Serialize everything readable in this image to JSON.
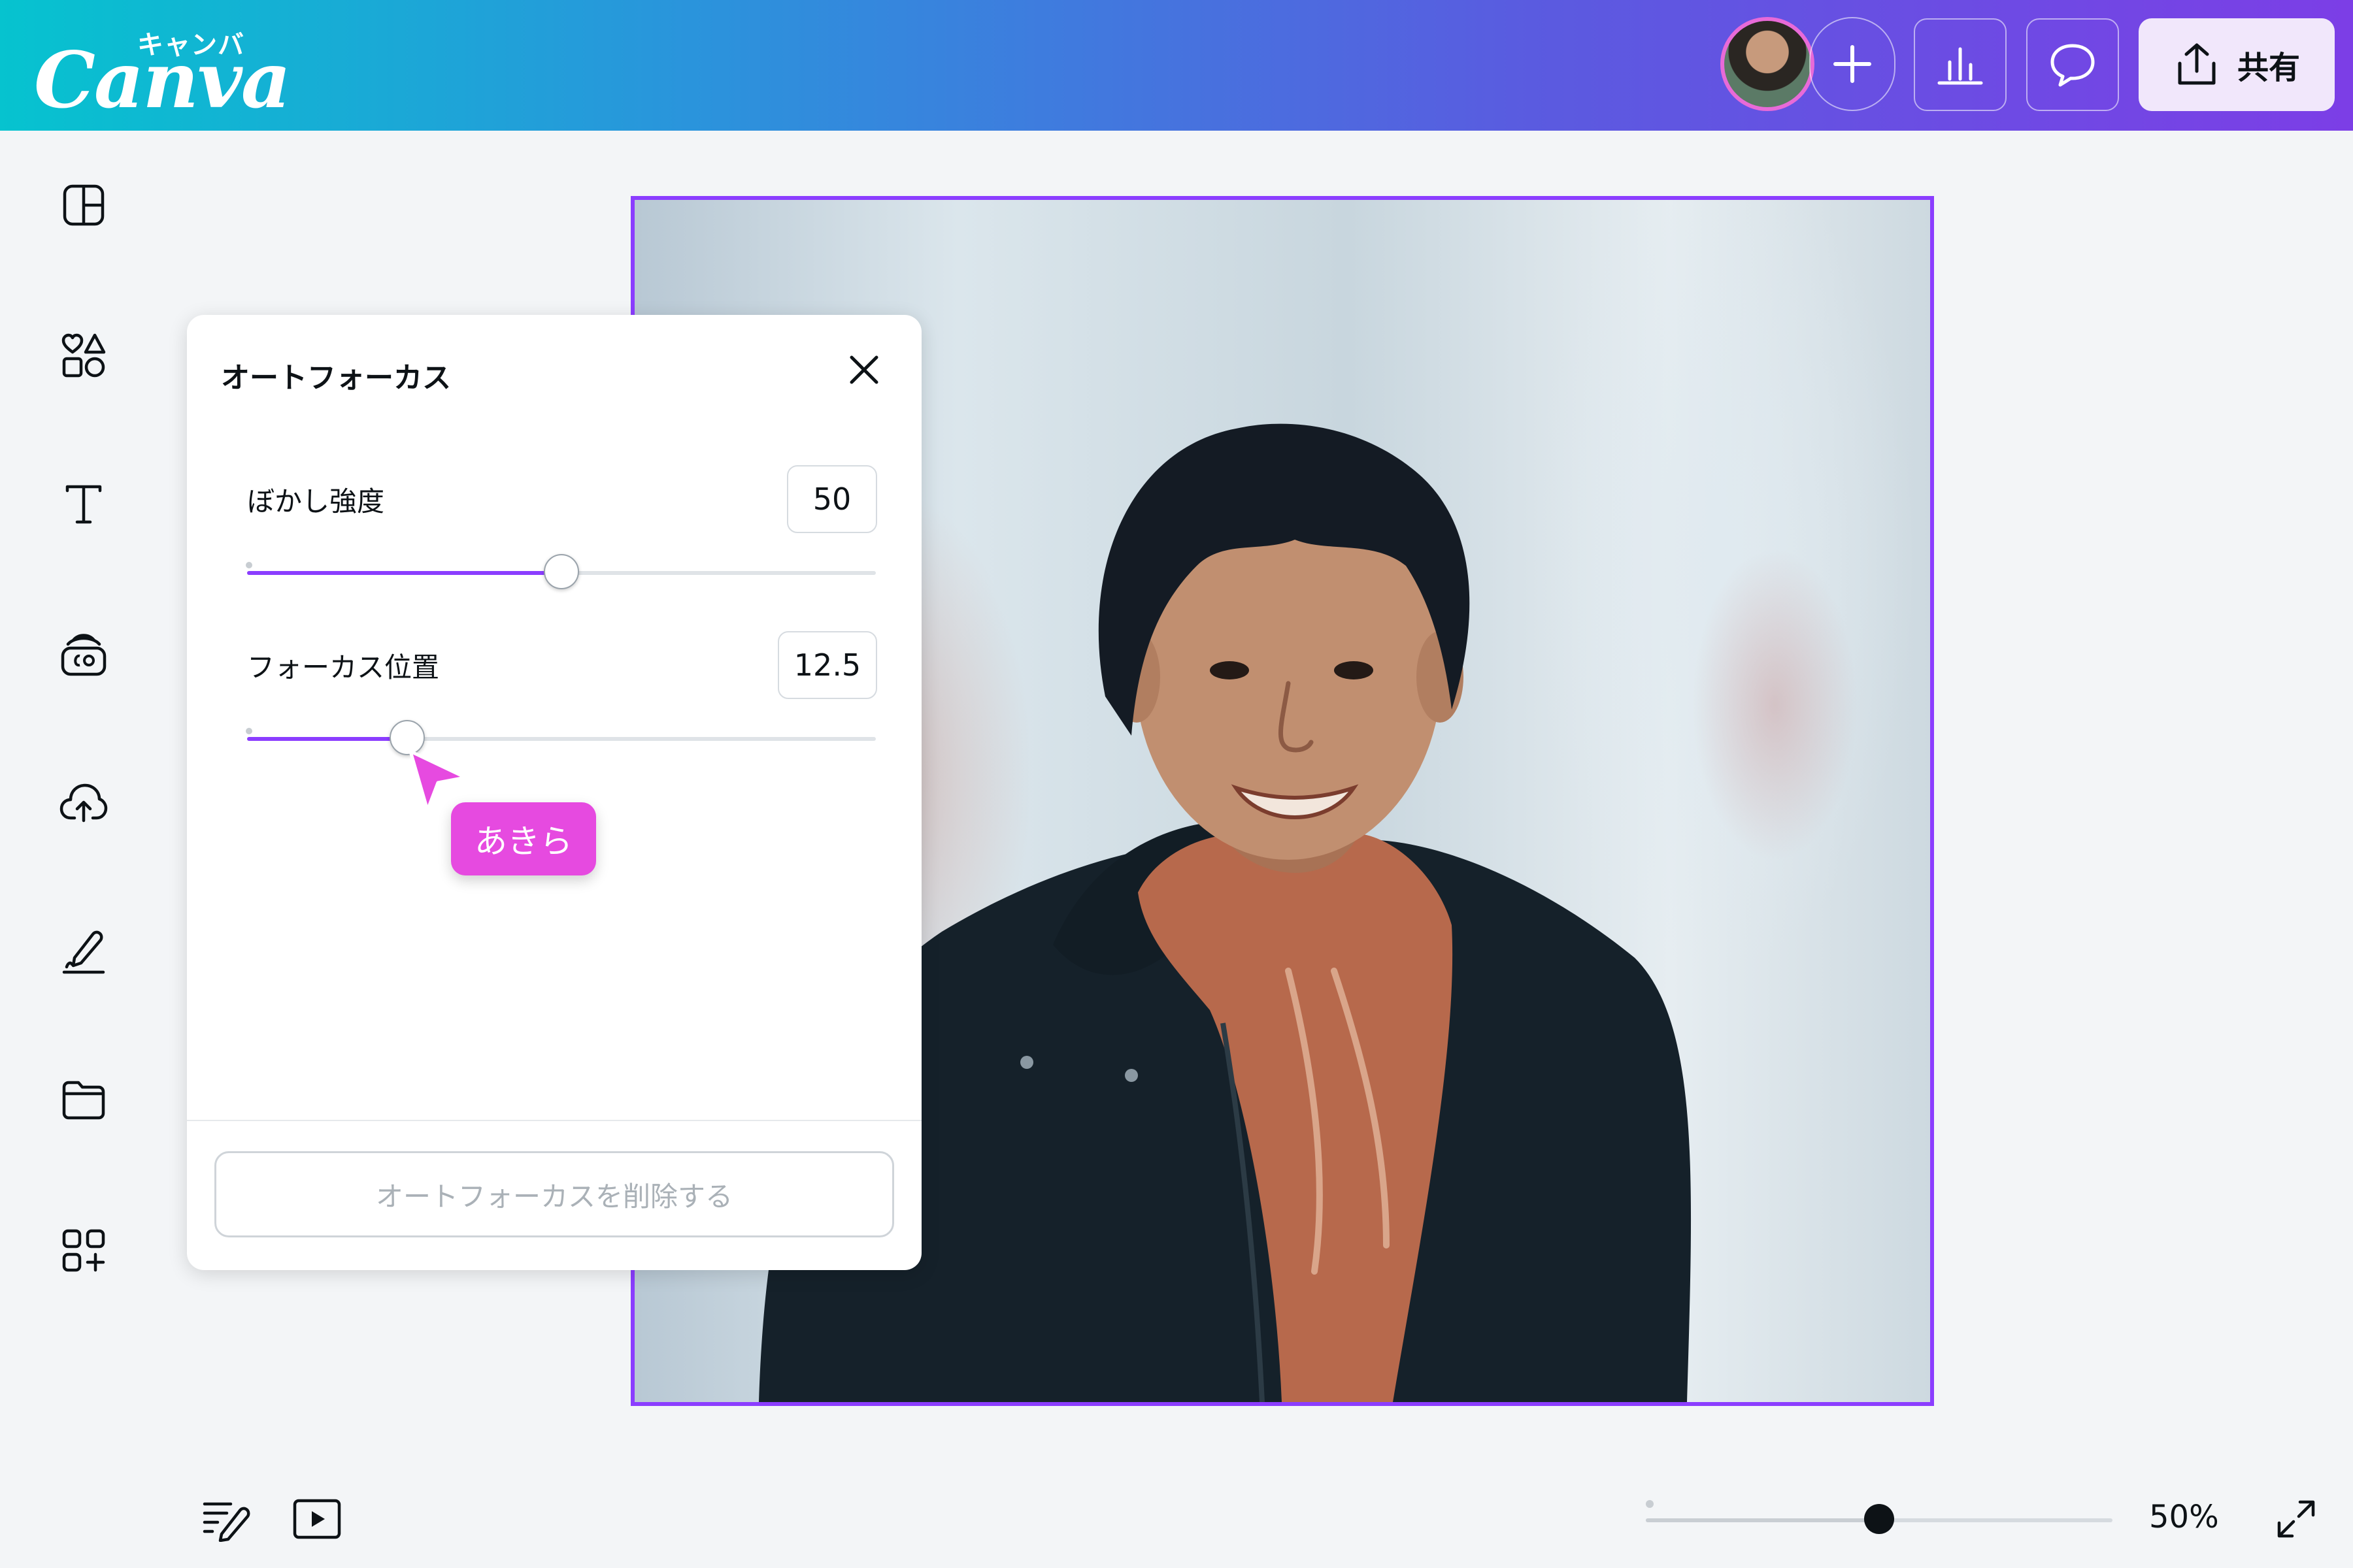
{
  "header": {
    "logo_text": "Canva",
    "logo_kana": "キャンバ",
    "add_label": "+",
    "share_label": "共有",
    "icons": [
      "avatar",
      "plus-icon",
      "chart-icon",
      "comment-icon",
      "share-icon"
    ]
  },
  "sidebar": {
    "icons": [
      "layout-icon",
      "elements-icon",
      "text-icon",
      "brand-icon",
      "upload-cloud-icon",
      "draw-icon",
      "folder-icon",
      "apps-icon"
    ]
  },
  "panel": {
    "title": "オートフォーカス",
    "blur": {
      "label": "ぼかし強度",
      "value": "50",
      "level": 0.5
    },
    "focus": {
      "label": "フォーカス位置",
      "value": "12.5",
      "level": 0.255
    },
    "remove_label": "オートフォーカスを削除する"
  },
  "collaborator": {
    "name": "あきら",
    "color": "#e64ae0"
  },
  "footer": {
    "zoom_label": "50%",
    "zoom_level": 0.5,
    "icons": [
      "notes-icon",
      "present-icon",
      "fullscreen-icon"
    ]
  },
  "colors": {
    "accent": "#8b3dff",
    "cursor": "#e64ae0",
    "gradient_start": "#06c3cf",
    "gradient_end": "#7c3ee6"
  }
}
